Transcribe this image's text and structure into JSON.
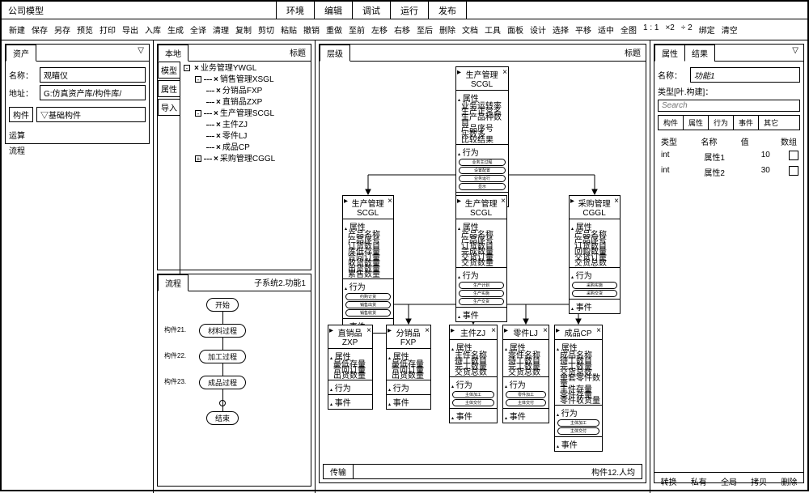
{
  "app": {
    "title": "公司模型"
  },
  "topmenu": [
    "环境",
    "编辑",
    "调试",
    "运行",
    "发布"
  ],
  "toolbar": [
    "新建",
    "保存",
    "另存",
    "预览",
    "打印",
    "导出",
    "入库",
    "生成",
    "全译",
    "清理",
    "复制",
    "剪切",
    "粘贴",
    "撤销",
    "重做",
    "至前",
    "左移",
    "右移",
    "至后",
    "删除",
    "文档",
    "工具",
    "面板",
    "设计",
    "选择",
    "平移",
    "适中",
    "全图",
    "1 : 1",
    "×2",
    "÷ 2",
    "绑定",
    "清空"
  ],
  "assets": {
    "tab": "资产",
    "name_label": "名称：",
    "name_value": "观瞄仪",
    "addr_label": "地址：",
    "addr_value": "G:仿真资产库/构件库/",
    "list_header": "构件",
    "list_value": "▽基础构件",
    "side": [
      "运算",
      "流程"
    ]
  },
  "local": {
    "tab": "本地",
    "title": "标题",
    "vtabs": [
      "模型",
      "属性",
      "导入"
    ],
    "tree": [
      {
        "lvl": 0,
        "exp": "-",
        "x": true,
        "t": "业务管理YWGL"
      },
      {
        "lvl": 1,
        "exp": "-",
        "x": true,
        "t": "销售管理XSGL"
      },
      {
        "lvl": 2,
        "exp": "",
        "x": true,
        "t": "分销品FXP"
      },
      {
        "lvl": 2,
        "exp": "",
        "x": true,
        "t": "直销品ZXP"
      },
      {
        "lvl": 1,
        "exp": "-",
        "x": true,
        "t": "生产管理SCGL"
      },
      {
        "lvl": 2,
        "exp": "",
        "x": true,
        "t": "主件ZJ"
      },
      {
        "lvl": 2,
        "exp": "",
        "x": true,
        "t": "零件LJ"
      },
      {
        "lvl": 2,
        "exp": "",
        "x": true,
        "t": "成品CP"
      },
      {
        "lvl": 1,
        "exp": "+",
        "x": true,
        "t": "采购管理CGGL"
      }
    ]
  },
  "flow": {
    "tab": "流程",
    "title": "子系统2.功能1",
    "nodes": [
      "开始",
      "材料过程",
      "加工过程",
      "成品过程",
      "结束"
    ],
    "labels": [
      "构件21.",
      "构件22.",
      "构件23."
    ]
  },
  "hier": {
    "tab": "层级",
    "title": "标题",
    "transport": {
      "tab": "传输",
      "right": "构件12.人均"
    }
  },
  "boxes": {
    "b1": {
      "title": "生产管理SCGL",
      "attrs": [
        "业务运转率",
        "生产正常名",
        "生产品种数目",
        "产品序号",
        "实数多",
        "比较结果"
      ],
      "acts": [
        "业务主过程",
        "设置配置",
        "业务运行",
        "显示"
      ],
      "ev": "事件"
    },
    "b2": {
      "title": "生产管理SCGL",
      "attrs": [
        "产品名称",
        "产品序号",
        "订货数目",
        "库低存量",
        "合同订量",
        "收货数量",
        "出货数量",
        "累售数量"
      ],
      "acts": [
        "约购订货",
        "销售出货",
        "销售收货"
      ],
      "ev": "事件"
    },
    "b3": {
      "title": "生产管理SCGL",
      "attrs": [
        "产品名称",
        "产品序号",
        "订货数目",
        "完成数量",
        "交货订量",
        "交货数量"
      ],
      "acts": [
        "生产计划",
        "生产实施",
        "生产交货"
      ],
      "ev": "事件"
    },
    "b4": {
      "title": "采购管理CGGL",
      "attrs": [
        "产品名称",
        "产品序号",
        "订货数目",
        "回购数量",
        "交货订量",
        "交货总数"
      ],
      "acts": [
        "采购实施",
        "采购交货"
      ],
      "ev": "事件"
    },
    "b5": {
      "title": "直销品ZXP",
      "attrs": [
        "最低存量",
        "合同订量",
        "出货数量"
      ],
      "ev": "事件"
    },
    "b6": {
      "title": "分销品FXP",
      "attrs": [
        "最低存量",
        "合同订量",
        "出货数量"
      ],
      "ev": "事件"
    },
    "b7": {
      "title": "主件ZJ",
      "attrs": [
        "主件名称",
        "待工数目",
        "完工数量",
        "交货总数"
      ],
      "acts": [
        "主体加工",
        "主体交付"
      ],
      "ev": "事件"
    },
    "b8": {
      "title": "零件LJ",
      "attrs": [
        "零件名称",
        "待工数目",
        "完工数量",
        "交货总数"
      ],
      "acts": [
        "零件加工",
        "主体交付"
      ],
      "ev": "事件"
    },
    "b9": {
      "title": "成品CP",
      "attrs": [
        "成品名称",
        "待工数目",
        "完工数量",
        "交货总数",
        "单套零件数量",
        "主件存量",
        "零件存量",
        "零件收货量"
      ],
      "acts": [
        "主体加工",
        "主体交付"
      ],
      "ev": "事件"
    },
    "section_attr": "属性",
    "section_act": "行为"
  },
  "props": {
    "tabs": [
      "属性",
      "结果"
    ],
    "name_label": "名称：",
    "name_value": "功能1",
    "type_label": "类型[叶.构建]：",
    "search_ph": "Search",
    "subtabs": [
      "构件",
      "属性",
      "行为",
      "事件",
      "其它"
    ],
    "cols": [
      "类型",
      "名称",
      "值",
      "数组"
    ],
    "rows": [
      {
        "type": "int",
        "name": "属性1",
        "val": "10"
      },
      {
        "type": "int",
        "name": "属性2",
        "val": "30"
      }
    ],
    "footer": [
      "转换",
      "私有",
      "全局",
      "拷贝",
      "删除"
    ]
  }
}
